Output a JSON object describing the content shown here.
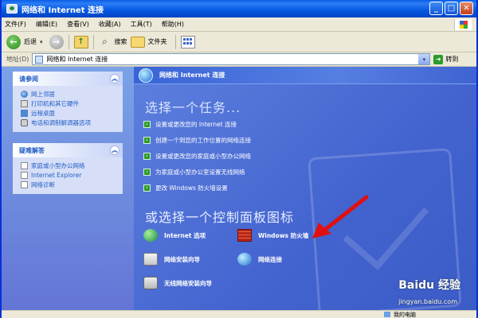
{
  "window": {
    "title": "网络和 Internet 连接",
    "min": "_",
    "max": "□",
    "close": "✕"
  },
  "menu": [
    "文件(F)",
    "编辑(E)",
    "查看(V)",
    "收藏(A)",
    "工具(T)",
    "帮助(H)"
  ],
  "toolbar": {
    "back": "后退",
    "back_drop": "▾",
    "search": "搜索",
    "folders": "文件夹"
  },
  "address": {
    "label": "地址(D)",
    "value": "网络和 Internet 连接",
    "go": "转到",
    "drop": "▾"
  },
  "see_also": {
    "title": "请参阅",
    "toggle": "︽",
    "items": [
      "网上邻居",
      "打印机和其它硬件",
      "远程桌面",
      "电话和调制解调器选项"
    ]
  },
  "troubleshoot": {
    "title": "疑难解答",
    "toggle": "︽",
    "items": [
      "家庭或小型办公网络",
      "Internet Explorer",
      "网络诊断"
    ]
  },
  "content": {
    "header": "网络和 Internet 连接",
    "pick_task": "选择一个任务...",
    "tasks": [
      "设置或更改您的 Internet 连接",
      "创建一个到您的工作位置的网络连接",
      "设置或更改您的家庭或小型办公网络",
      "为家庭或小型办公室设置无线网络",
      "更改 Windows 防火墙设置"
    ],
    "pick_icon": "或选择一个控制面板图标",
    "icons": [
      "Internet 选项",
      "Windows 防火墙",
      "网络安装向导",
      "网络连接",
      "无线网络安装向导"
    ]
  },
  "watermark": {
    "brand": "Baidu 经验",
    "url": "jingyan.baidu.com"
  },
  "status": {
    "text": "我的电脑"
  },
  "colors": {
    "accent": "#0a5ee6",
    "arrow": "#e01010"
  }
}
